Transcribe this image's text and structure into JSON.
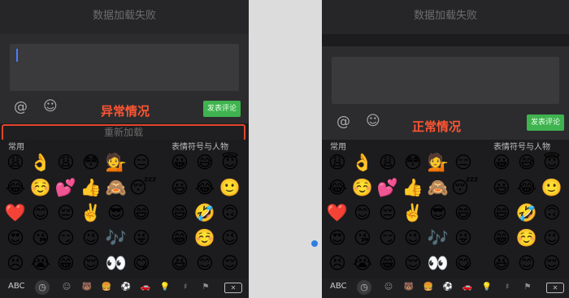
{
  "left": {
    "topbar_title": "数据加载失败",
    "annotation": "异常情况",
    "send_label": "发表评论",
    "reload_label": "重新加载",
    "section_frequent": "常用",
    "section_smileys": "表情符号与人物",
    "frequent_emojis": [
      "😩",
      "👌",
      "😩",
      "😳",
      "💁",
      "😑",
      "😂",
      "☺️",
      "💕",
      "👍",
      "🙈",
      "😴",
      "❤️",
      "😊",
      "😔",
      "✌️",
      "😎",
      "😄",
      "😍",
      "😘",
      "😏",
      "😉",
      "🎶",
      "😜",
      "😣",
      "😭",
      "😁",
      "😌",
      "👀",
      "😋"
    ],
    "smiley_emojis": [
      "😀",
      "😅",
      "😇",
      "😃",
      "😂",
      "🙂",
      "😄",
      "🤣",
      "🙃",
      "😁",
      "☺️",
      "😉",
      "😆",
      "😊",
      "😌"
    ]
  },
  "right": {
    "topbar_title": "数据加载失败",
    "annotation": "正常情况",
    "send_label": "发表评论",
    "section_frequent": "常用",
    "section_smileys": "表情符号与人物",
    "frequent_emojis": [
      "😩",
      "👌",
      "😩",
      "😳",
      "💁",
      "😑",
      "😂",
      "☺️",
      "💕",
      "👍",
      "🙈",
      "😴",
      "❤️",
      "😊",
      "😔",
      "✌️",
      "😎",
      "😄",
      "😍",
      "😘",
      "😏",
      "😉",
      "🎶",
      "😜",
      "😣",
      "😭",
      "😁",
      "😌",
      "👀",
      "😋"
    ],
    "smiley_emojis": [
      "😀",
      "😅",
      "😇",
      "😃",
      "😂",
      "🙂",
      "😄",
      "🤣",
      "🙃",
      "😁",
      "☺️",
      "😉",
      "😆",
      "😊",
      "😌"
    ]
  },
  "keyboard": {
    "abc_label": "ABC",
    "clock_glyph": "◷",
    "categories": [
      "☺",
      "🐻",
      "🍔",
      "⚽",
      "🚗",
      "💡",
      "♯",
      "⚑"
    ],
    "delete_glyph": "✕"
  },
  "accent": {
    "red": "#e2452a",
    "send_green": "#3fb34f",
    "cursor_blue": "#4a7cff"
  }
}
